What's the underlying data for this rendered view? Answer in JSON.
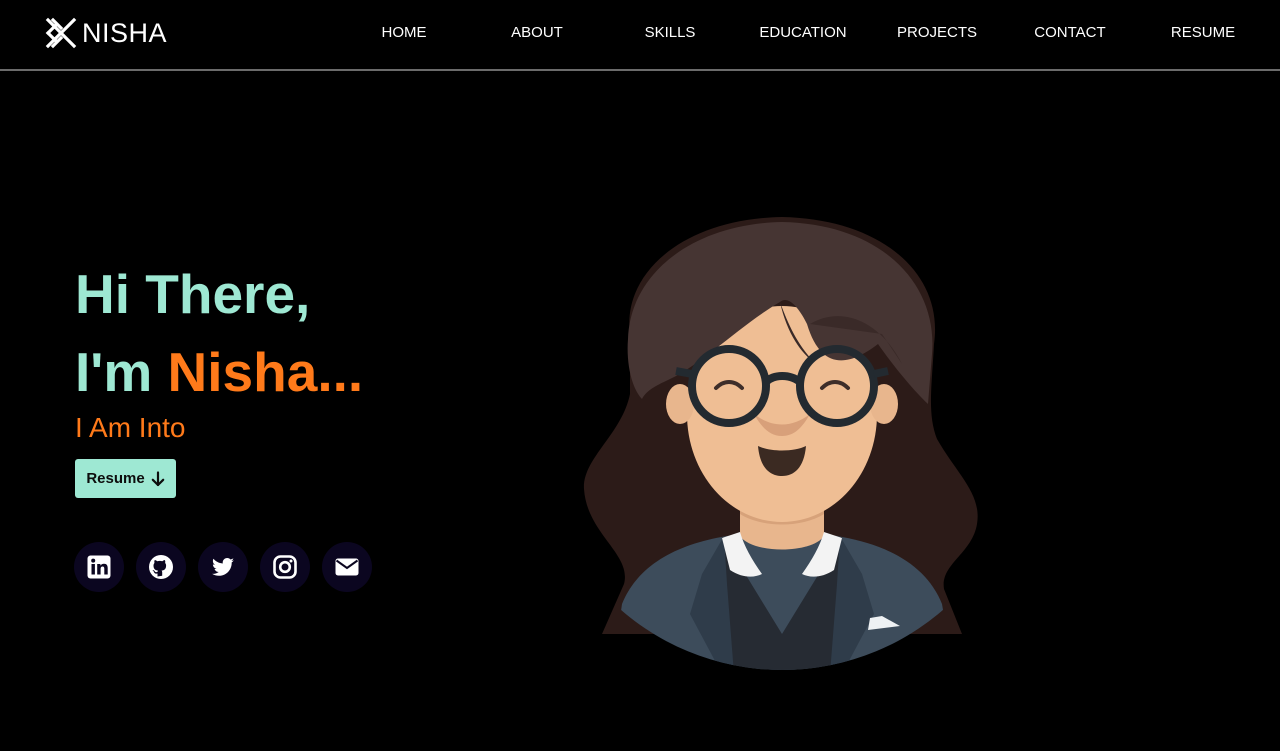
{
  "brand": {
    "name": "NISHA",
    "icon": "crossed-logo-icon"
  },
  "nav": {
    "items": [
      {
        "label": "HOME"
      },
      {
        "label": "ABOUT"
      },
      {
        "label": "SKILLS"
      },
      {
        "label": "EDUCATION"
      },
      {
        "label": "PROJECTS"
      },
      {
        "label": "CONTACT"
      },
      {
        "label": "RESUME"
      }
    ]
  },
  "hero": {
    "greeting": "Hi There,",
    "intro": "I'm ",
    "name": "Nisha...",
    "tagline": "I Am Into",
    "resume_button": {
      "label": "Resume",
      "icon": "arrow-down-icon"
    },
    "socials": [
      {
        "icon": "linkedin-icon"
      },
      {
        "icon": "github-icon"
      },
      {
        "icon": "twitter-icon"
      },
      {
        "icon": "instagram-icon"
      },
      {
        "icon": "envelope-icon"
      }
    ]
  },
  "colors": {
    "background": "#000000",
    "accent_mint": "#9ee8d3",
    "accent_orange": "#ff7a1a",
    "social_bg": "#0b0620"
  }
}
